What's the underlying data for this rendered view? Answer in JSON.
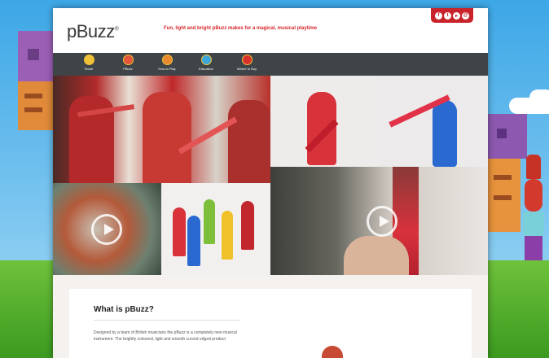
{
  "header": {
    "logo": "pBuzz",
    "tagline": "Fun, light and bright pBuzz makes for a magical, musical playtime",
    "social_icons": [
      "facebook-icon",
      "twitter-icon",
      "youtube-icon",
      "email-icon"
    ]
  },
  "nav": {
    "items": [
      {
        "label": "Home",
        "icon": "home-icon"
      },
      {
        "label": "PBuzz",
        "icon": "pbuzz-icon"
      },
      {
        "label": "How to Play",
        "icon": "how-to-play-icon"
      },
      {
        "label": "Education",
        "icon": "education-icon"
      },
      {
        "label": "Where to Buy",
        "icon": "where-to-buy-icon"
      }
    ]
  },
  "about": {
    "title": "What is pBuzz?",
    "text": "Designed by a team of British musicians the pBuzz is a completely new musical instrument. The brightly coloured, light and smooth curved edged product"
  },
  "colors": {
    "accent_red": "#d6262b",
    "nav_bg": "#3e4447",
    "nav_icon_ring": "#f0c23a"
  }
}
